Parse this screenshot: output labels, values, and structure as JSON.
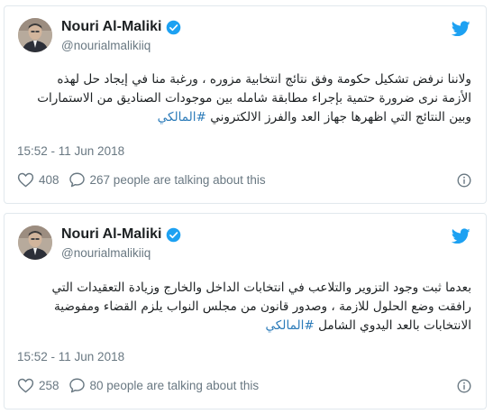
{
  "brand_color": "#1da1f2",
  "tweets": [
    {
      "author": {
        "name": "Nouri Al-Maliki",
        "handle": "@nourialmalikiiq",
        "verified_icon": "verified-badge-icon"
      },
      "text_lines": [
        "ولاننا نرفض تشكيل حكومة وفق نتائج انتخابية مزوره ، ورغبة منا في إيجاد حل لهذه",
        "الأزمة نرى ضرورة حتمية بإجراء مطابقة شامله بين موجودات الصناديق من الاستمارات",
        "وبين النتائج التي اظهرها جهاز العد والفرز الالكتروني"
      ],
      "hashtag": "#المالكي",
      "timestamp": "15:52 - 11 Jun 2018",
      "likes": "408",
      "talking": "267 people are talking about this"
    },
    {
      "author": {
        "name": "Nouri Al-Maliki",
        "handle": "@nourialmalikiiq",
        "verified_icon": "verified-badge-icon"
      },
      "text_lines": [
        "بعدما ثبت وجود التزوير والتلاعب في انتخابات الداخل والخارج وزيادة التعقيدات التي",
        "رافقت وضع الحلول للازمة ، وصدور قانون من مجلس النواب يلزم القضاء ومفوضية",
        "الانتخابات بالعد اليدوي الشامل"
      ],
      "hashtag": "#المالكي",
      "timestamp": "15:52 - 11 Jun 2018",
      "likes": "258",
      "talking": "80 people are talking about this"
    }
  ]
}
